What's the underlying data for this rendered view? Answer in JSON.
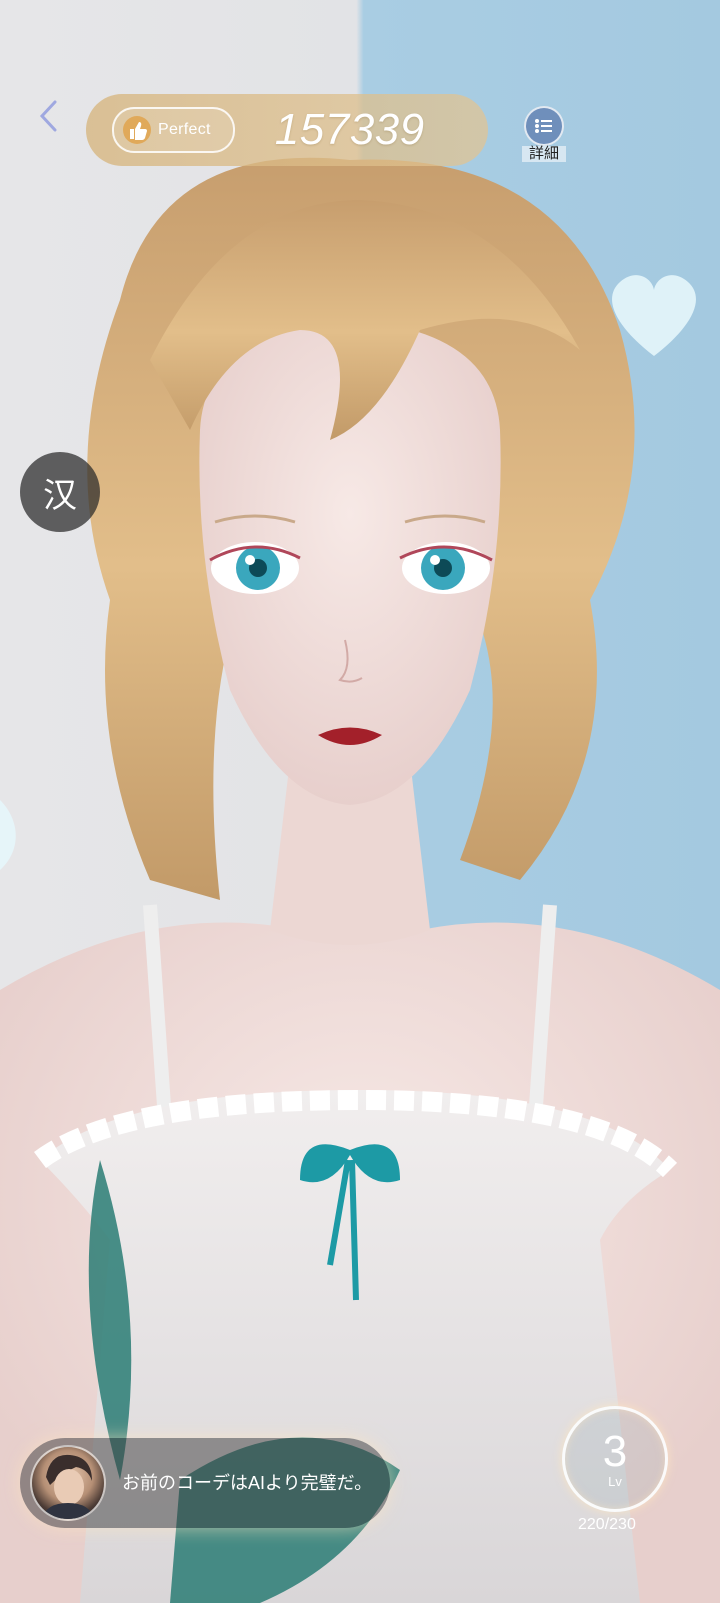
{
  "topbar": {
    "badge_label": "Perfect",
    "score": "157339",
    "detail_label": "詳細"
  },
  "lang_toggle": {
    "label": "汉"
  },
  "dialogue": {
    "text": "お前のコーデはAIより完璧だ。"
  },
  "level": {
    "value": "3",
    "unit": "Lv",
    "exp": "220/230"
  },
  "colors": {
    "bg_left": "#e4e4e6",
    "bg_right": "#a7cbe2",
    "score_pill": "#d8b682",
    "detail_button": "#6f8fbb"
  },
  "icons": [
    "back-chevron-icon",
    "thumbs-up-icon",
    "list-icon",
    "heart-icon"
  ]
}
